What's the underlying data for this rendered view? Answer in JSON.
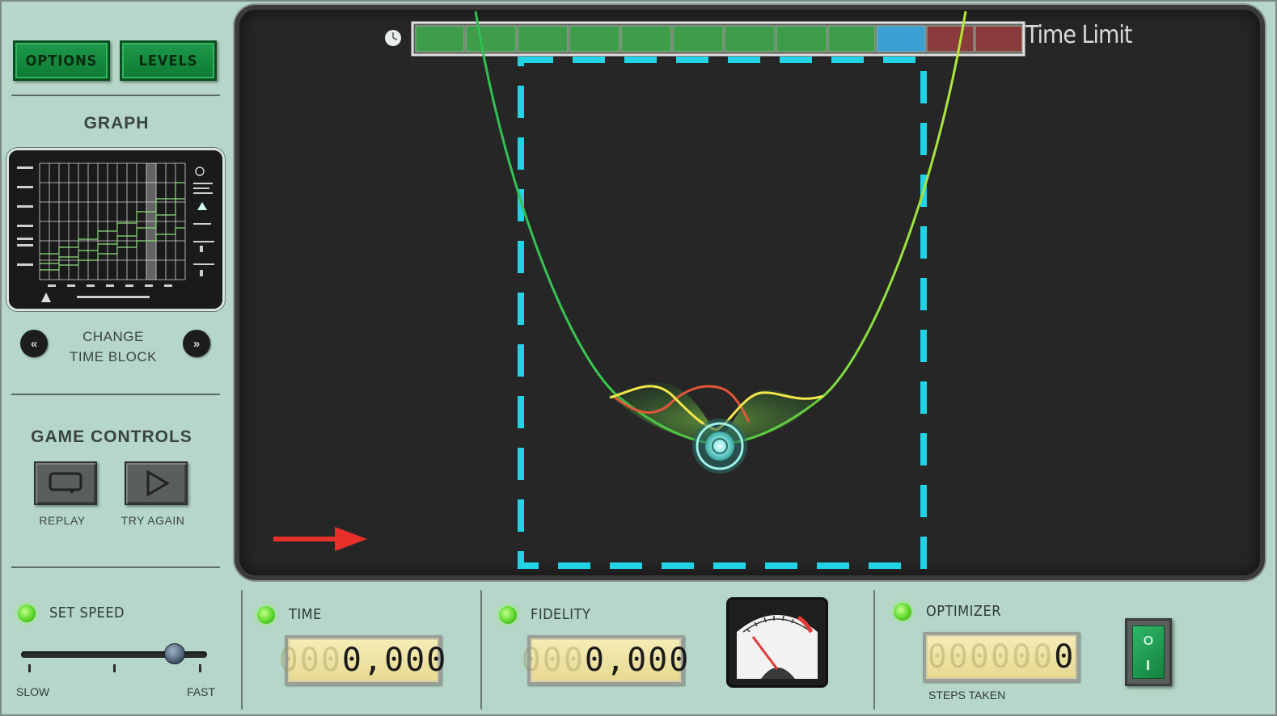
{
  "left_panel": {
    "options_label": "OPTIONS",
    "levels_label": "LEVELS",
    "graph_title": "GRAPH",
    "change_time_block_line1": "CHANGE",
    "change_time_block_line2": "TIME BLOCK",
    "prev_icon": "double-chevron-left",
    "next_icon": "double-chevron-right",
    "game_controls_title": "GAME CONTROLS",
    "replay_label": "REPLAY",
    "try_again_label": "TRY AGAIN"
  },
  "screen": {
    "time_limit_label": "Time Limit",
    "time_limit_segments": [
      "green",
      "green",
      "green",
      "green",
      "green",
      "green",
      "green",
      "green",
      "green",
      "blue",
      "red",
      "red"
    ],
    "arrow_color": "#e8302a",
    "box_color": "#22d3e6"
  },
  "bottom": {
    "speed_label": "SET SPEED",
    "slow_label": "SLOW",
    "fast_label": "FAST",
    "speed_level": 0.8,
    "time_label": "TIME",
    "time_ghost": "000",
    "time_value": "0,000",
    "fidelity_label": "FIDELITY",
    "fidelity_ghost": "000",
    "fidelity_value": "0,000",
    "optimizer_label": "OPTIMIZER",
    "optimizer_ghost": "000000",
    "optimizer_value": "0",
    "steps_label": "STEPS TAKEN",
    "toggle_symbol": "O"
  },
  "colors": {
    "panel_bg": "#b5d6c8",
    "screen_bg": "#262626",
    "button_green": "#1f9a4a",
    "led_green": "#5bd72b",
    "lcd_bg": "#f0e6a8"
  }
}
